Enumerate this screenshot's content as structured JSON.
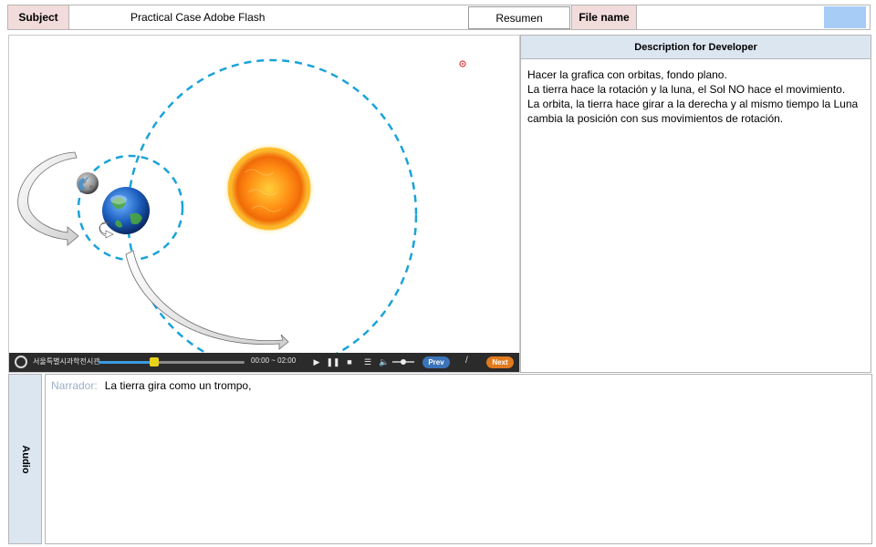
{
  "header": {
    "subject_label": "Subject",
    "subject_value": "Practical Case Adobe Flash",
    "summary_button": "Resumen",
    "file_name_label": "File name",
    "file_name_value": "",
    "file_swatch_color": "#a7cdf7"
  },
  "stage": {
    "scene_icons": [
      "sun-icon",
      "earth-icon",
      "moon-icon",
      "orbit-arrow-icon"
    ],
    "orbit_color": "#1aa3d9",
    "player": {
      "brand": "서울특별시과학전시관",
      "time": "00:00 ~ 02:00",
      "progress": 0.38,
      "volume": 0.5,
      "prev_label": "Prev",
      "separator": "/",
      "next_label": "Next",
      "controls": [
        "play-icon",
        "pause-icon",
        "stop-icon",
        "list-icon",
        "volume-icon"
      ]
    }
  },
  "description": {
    "title": "Description for Developer",
    "lines": [
      "Hacer la grafica con orbitas, fondo plano.",
      "La tierra hace la rotación y la luna, el Sol NO hace el movimiento.",
      "La orbita, la tierra hace girar a la derecha  y al mismo tiempo la Luna cambia la posición con sus movimientos de rotación."
    ]
  },
  "audio": {
    "label": "Audio",
    "speaker": "Narrador:",
    "text": "La tierra gira como un trompo,"
  }
}
